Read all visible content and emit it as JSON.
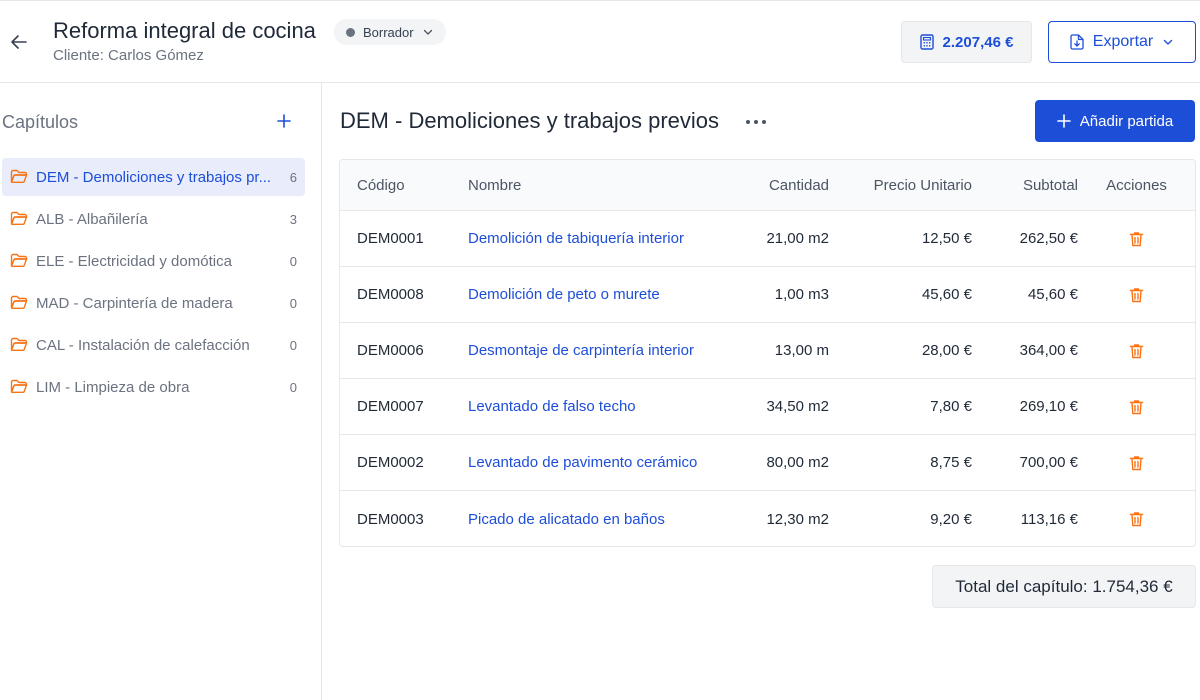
{
  "header": {
    "title": "Reforma integral de cocina",
    "subtitle": "Cliente: Carlos Gómez",
    "status_label": "Borrador",
    "total": "2.207,46 €",
    "export_label": "Exportar"
  },
  "sidebar": {
    "title": "Capítulos",
    "items": [
      {
        "label": "DEM - Demoliciones y trabajos pr...",
        "count": "6"
      },
      {
        "label": "ALB - Albañilería",
        "count": "3"
      },
      {
        "label": "ELE - Electricidad y domótica",
        "count": "0"
      },
      {
        "label": "MAD - Carpintería de madera",
        "count": "0"
      },
      {
        "label": "CAL - Instalación de calefacción",
        "count": "0"
      },
      {
        "label": "LIM - Limpieza de obra",
        "count": "0"
      }
    ]
  },
  "main": {
    "heading": "DEM - Demoliciones y trabajos previos",
    "more_label": "···",
    "add_item_label": "Añadir partida",
    "columns": {
      "code": "Código",
      "name": "Nombre",
      "qty": "Cantidad",
      "price": "Precio Unitario",
      "subtotal": "Subtotal",
      "actions": "Acciones"
    },
    "rows": [
      {
        "code": "DEM0001",
        "name": "Demolición de tabiquería interior",
        "qty": "21,00 m2",
        "price": "12,50 €",
        "subtotal": "262,50 €"
      },
      {
        "code": "DEM0008",
        "name": "Demolición de peto o murete",
        "qty": "1,00 m3",
        "price": "45,60 €",
        "subtotal": "45,60 €"
      },
      {
        "code": "DEM0006",
        "name": "Desmontaje de carpintería interior",
        "qty": "13,00 m",
        "price": "28,00 €",
        "subtotal": "364,00 €"
      },
      {
        "code": "DEM0007",
        "name": "Levantado de falso techo",
        "qty": "34,50 m2",
        "price": "7,80 €",
        "subtotal": "269,10 €"
      },
      {
        "code": "DEM0002",
        "name": "Levantado de pavimento cerámico",
        "qty": "80,00 m2",
        "price": "8,75 €",
        "subtotal": "700,00 €"
      },
      {
        "code": "DEM0003",
        "name": "Picado de alicatado en baños",
        "qty": "12,30 m2",
        "price": "9,20 €",
        "subtotal": "113,16 €"
      }
    ],
    "chapter_total": "Total del capítulo: 1.754,36 €"
  },
  "colors": {
    "accent": "#1d4ed8",
    "folder": "#f97316",
    "trash": "#f97316",
    "active_bg": "#e8ecfb"
  }
}
